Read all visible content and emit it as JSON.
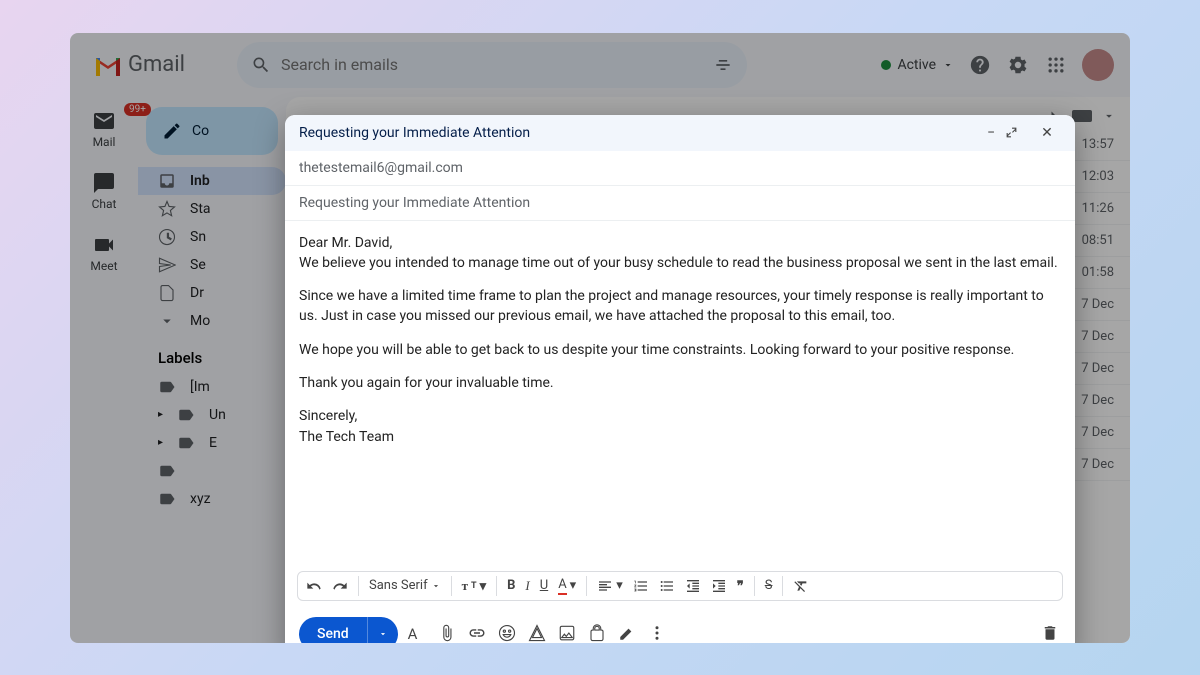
{
  "header": {
    "app_name": "Gmail",
    "search_placeholder": "Search in emails",
    "status": "Active"
  },
  "rail": {
    "mail": "Mail",
    "chat": "Chat",
    "meet": "Meet",
    "badge": "99+"
  },
  "compose_label": "Co",
  "nav": {
    "inbox": "Inb",
    "starred": "Sta",
    "snoozed": "Sn",
    "sent": "Se",
    "drafts": "Dr",
    "more": "Mo"
  },
  "labels_header": "Labels",
  "labels": [
    "[Im",
    "Un",
    "E",
    "",
    "xyz"
  ],
  "times": [
    "13:57",
    "12:03",
    "11:26",
    "08:51",
    "01:58",
    "7 Dec",
    "7 Dec",
    "7 Dec",
    "7 Dec",
    "7 Dec",
    "7 Dec"
  ],
  "compose": {
    "title": "Requesting your Immediate Attention",
    "to": "thetestemail6@gmail.com",
    "subject": "Requesting your Immediate Attention",
    "greeting": "Dear Mr. David,",
    "p1": "We believe you intended to manage time out of your busy schedule to read the business proposal we sent in the last email.",
    "p2": "Since we have a limited time frame to plan the project and manage resources, your timely response is really important to us. Just in case you missed our previous email, we have attached the proposal to this email, too.",
    "p3": "We hope you will be able to get back to us despite your time constraints. Looking forward to your positive response.",
    "p4": "Thank you again for your invaluable time.",
    "sig1": "Sincerely,",
    "sig2": "The Tech Team",
    "font": "Sans Serif",
    "send": "Send"
  }
}
